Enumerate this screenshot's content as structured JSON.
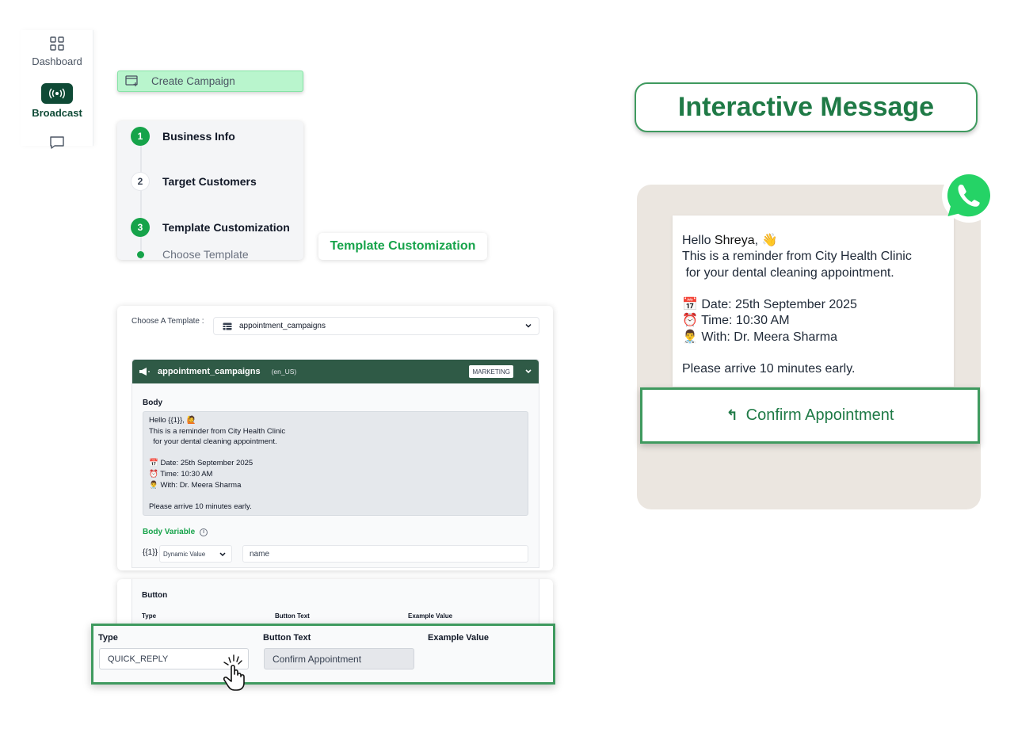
{
  "sidebar": {
    "items": [
      {
        "label": "Dashboard",
        "icon": "grid-icon"
      },
      {
        "label": "Broadcast",
        "icon": "broadcast-icon",
        "active": true
      },
      {
        "label": "",
        "icon": "chat-icon"
      }
    ]
  },
  "create_campaign": {
    "label": "Create Campaign",
    "icon": "campaign-icon"
  },
  "stepper": {
    "steps": [
      {
        "number": "1",
        "label": "Business Info",
        "state": "done"
      },
      {
        "number": "2",
        "label": "Target Customers",
        "state": "pending"
      },
      {
        "number": "3",
        "label": "Template Customization",
        "state": "done"
      }
    ],
    "substep": "Choose Template"
  },
  "template_tag": "Template Customization",
  "template": {
    "choose_label": "Choose A Template :",
    "selected": "appointment_campaigns",
    "card": {
      "name": "appointment_campaigns",
      "lang": "(en_US)",
      "category": "MARKETING",
      "body_label": "Body",
      "body_lines": [
        "Hello {{1}}, 🙋",
        "This is a reminder from City Health Clinic",
        "  for your dental cleaning appointment.",
        "",
        "📅 Date: 25th September 2025",
        "⏰ Time: 10:30 AM",
        "👨‍⚕️ With: Dr. Meera Sharma",
        "",
        "Please arrive 10 minutes early."
      ],
      "body_variable_label": "Body Variable",
      "variable": {
        "tag": "{{1}}",
        "type": "Dynamic Value",
        "value": "name"
      }
    }
  },
  "button_section": {
    "title": "Button",
    "columns": [
      "Type",
      "Button Text",
      "Example Value"
    ],
    "row": {
      "type": "QUICK_REPLY",
      "text": "Confirm Appointment",
      "example": ""
    }
  },
  "interactive": {
    "title": "Interactive Message",
    "message": {
      "greeting_prefix": "Hello ",
      "name": "Shreya",
      "greeting_suffix": ", 👋",
      "lines": [
        "This is a reminder from City Health Clinic",
        " for your dental cleaning appointment.",
        "",
        "📅 Date: 25th September 2025",
        "⏰ Time: 10:30 AM",
        "👨‍⚕️ With: Dr. Meera Sharma",
        "",
        "Please arrive 10 minutes early."
      ]
    },
    "button": "Confirm Appointment"
  },
  "colors": {
    "brand_dark": "#0f4a36",
    "brand_green": "#16a34a",
    "highlight_border": "#3f9a5f",
    "chat_bg": "#ebe6e0",
    "whatsapp": "#25d366"
  }
}
